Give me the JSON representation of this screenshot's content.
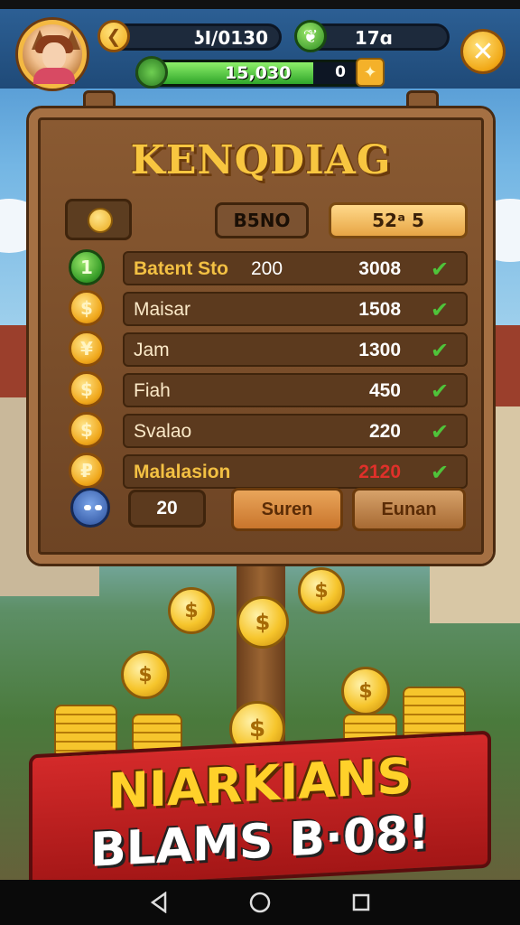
{
  "hud": {
    "coins_value": "ʖI/0130",
    "gems_value": "17ɑ",
    "xp_value": "15,030",
    "xp_secondary": "0",
    "xp_progress": 0.72
  },
  "board": {
    "title": "KENQDIAG",
    "tab_dark_label": "B5NO",
    "tab_gold_label": "52ᵃ 5",
    "rows": [
      {
        "name": "Batent Sto",
        "sub": "200",
        "value": "3008",
        "coin_symbol": "1",
        "coin_style": "green",
        "highlight": true,
        "value_red": false
      },
      {
        "name": "Maisar",
        "sub": "",
        "value": "1508",
        "coin_symbol": "$",
        "coin_style": "gold",
        "highlight": false,
        "value_red": false
      },
      {
        "name": "Jam",
        "sub": "",
        "value": "1300",
        "coin_symbol": "¥",
        "coin_style": "gold",
        "highlight": false,
        "value_red": false
      },
      {
        "name": "Fiah",
        "sub": "",
        "value": "450",
        "coin_symbol": "$",
        "coin_style": "gold",
        "highlight": false,
        "value_red": false
      },
      {
        "name": "Svalao",
        "sub": "",
        "value": "220",
        "coin_symbol": "$",
        "coin_style": "gold",
        "highlight": false,
        "value_red": false
      },
      {
        "name": "Malalasion",
        "sub": "",
        "value": "2120",
        "coin_symbol": "₽",
        "coin_style": "gold",
        "highlight": true,
        "value_red": true
      }
    ],
    "count_value": "20",
    "button_left": "Suren",
    "button_right": "Eunan"
  },
  "banner": {
    "line1": "NIARKIANS",
    "line2": "BLAMS B·08!"
  },
  "colors": {
    "gold_text": "#f8c640",
    "check_green": "#4fc33a",
    "banner_red": "#d42a2a"
  },
  "icons": {
    "close": "close-icon",
    "back": "back-icon",
    "home": "home-icon",
    "recents": "recents-icon"
  }
}
